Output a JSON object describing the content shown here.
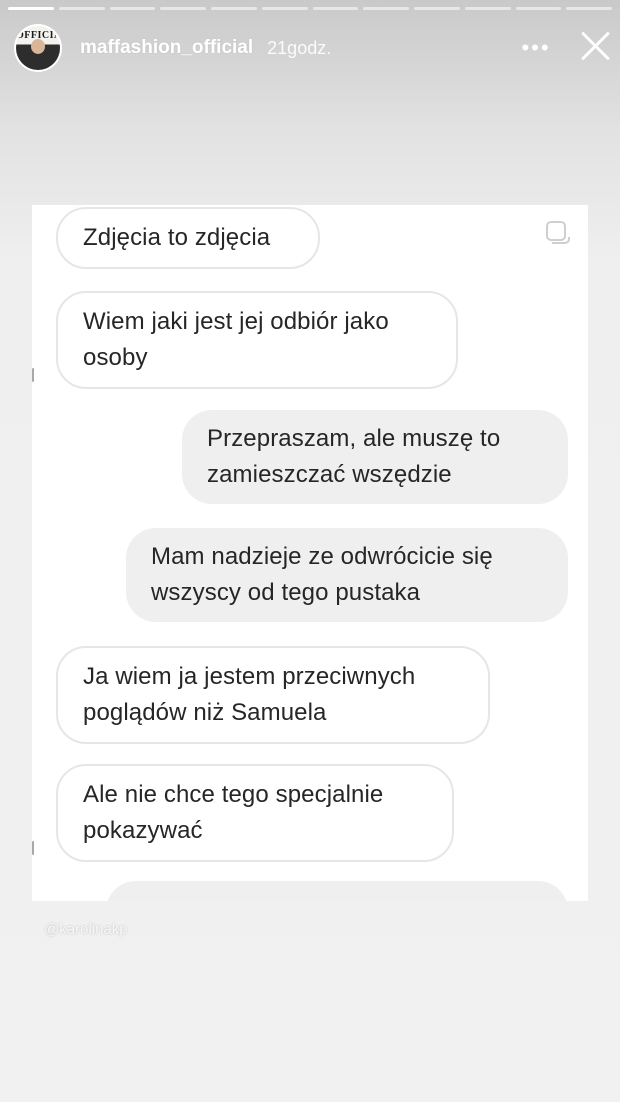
{
  "story": {
    "segments": 12,
    "active_segment": 1,
    "username": "maffashion_official",
    "time": "21godz.",
    "avatar_logo": "OFFICIAL",
    "more_glyph": "•••",
    "watermark": "@karolinakp"
  },
  "messages": [
    {
      "side": "received",
      "text": "Zdjęcia to zdjęcia"
    },
    {
      "side": "received",
      "text": "Wiem jaki jest jej odbiór jako osoby"
    },
    {
      "side": "sent",
      "text": "Przepraszam, ale muszę to zamieszczać wszędzie"
    },
    {
      "side": "sent",
      "text": "Mam nadzieje ze odwrócicie się wszyscy od tego pustaka"
    },
    {
      "side": "received",
      "text": "Ja wiem ja jestem przeciwnych poglądów niż Samuela"
    },
    {
      "side": "received",
      "text": "Ale nie chce tego specjalnie pokazywać"
    },
    {
      "side": "sent",
      "text": ""
    }
  ]
}
